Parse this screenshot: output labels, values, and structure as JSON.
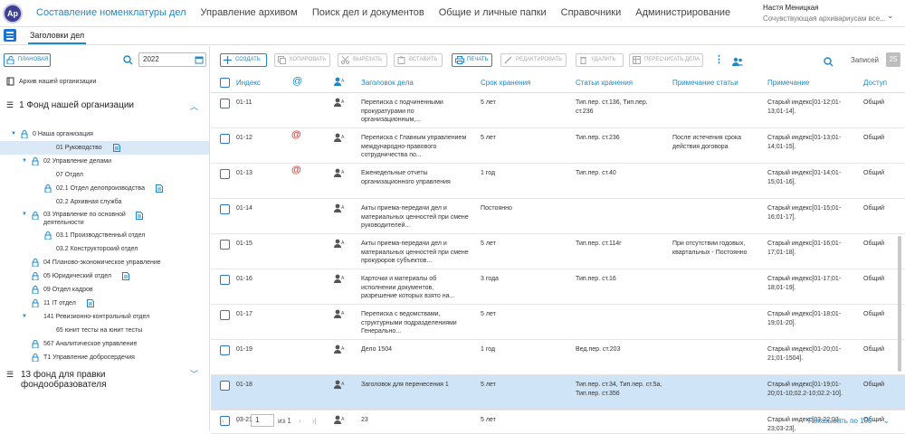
{
  "app": {
    "logo": "Ap",
    "nav": [
      "Составление номенклатуры дел",
      "Управление архивом",
      "Поиск дел и документов",
      "Общие и личные папки",
      "Справочники",
      "Администрирование"
    ],
    "user_name": "Настя Меницкая",
    "user_role": "Сочувствующая архивариусам все..."
  },
  "tab": "Заголовки дел",
  "left": {
    "plan_label": "ПЛАНОВАЯ",
    "year": "2022",
    "archive": "Архив нашей организации",
    "fond1": "1 Фонд нашей организации",
    "fond2": "13 фонд для правки фондообразователя",
    "tree": [
      {
        "label": "0 Наша организация",
        "level": 0,
        "arrow": true,
        "lock": true,
        "doc": false
      },
      {
        "label": "01 Руководство",
        "level": 2,
        "arrow": false,
        "lock": false,
        "doc": true,
        "selected": true
      },
      {
        "label": "02 Управление делами",
        "level": 1,
        "arrow": true,
        "lock": true,
        "doc": false
      },
      {
        "label": "07 Отдел",
        "level": 2,
        "arrow": false,
        "lock": false,
        "doc": false
      },
      {
        "label": "02.1 Отдел делопроизводства",
        "level": 2,
        "arrow": false,
        "lock": true,
        "doc": true
      },
      {
        "label": "02.2 Архивная служба",
        "level": 2,
        "arrow": false,
        "lock": false,
        "doc": false
      },
      {
        "label": "03 Управление по основной деятельности",
        "level": 1,
        "arrow": true,
        "lock": true,
        "doc": true,
        "two": true
      },
      {
        "label": "03.1 Производственный отдел",
        "level": 2,
        "arrow": false,
        "lock": true,
        "doc": false
      },
      {
        "label": "03.2 Конструкторский отдел",
        "level": 2,
        "arrow": false,
        "lock": false,
        "doc": false
      },
      {
        "label": "04 Планово-экономическое управление",
        "level": 1,
        "arrow": false,
        "lock": true,
        "doc": false
      },
      {
        "label": "05 Юридический отдел",
        "level": 1,
        "arrow": false,
        "lock": true,
        "doc": true
      },
      {
        "label": "09 Отдел кадров",
        "level": 1,
        "arrow": false,
        "lock": true,
        "doc": false
      },
      {
        "label": "11 IT отдел",
        "level": 1,
        "arrow": false,
        "lock": true,
        "doc": true
      },
      {
        "label": "141 Ревизионно-контрольный отдел",
        "level": 1,
        "arrow": true,
        "lock": false,
        "doc": false
      },
      {
        "label": "65 юнит тесты на юнит тесты",
        "level": 2,
        "arrow": false,
        "lock": false,
        "doc": false
      },
      {
        "label": "567 Аналитическое управление",
        "level": 1,
        "arrow": false,
        "lock": true,
        "doc": false
      },
      {
        "label": "T1 Управление добросердечия",
        "level": 1,
        "arrow": false,
        "lock": true,
        "doc": false
      }
    ]
  },
  "toolbar": {
    "create": "СОЗДАТЬ",
    "copy": "КОПИРОВАТЬ",
    "cut": "ВЫРЕЗАТЬ",
    "paste": "ВСТАВИТЬ",
    "print": "ПЕЧАТЬ",
    "edit": "РЕДАКТИРОВАТЬ",
    "delete": "УДАЛИТЬ",
    "recalc": "ПЕРЕСЧИТАТЬ ДЕЛА",
    "records_label": "Записей",
    "records_count": "25"
  },
  "table": {
    "headers": {
      "index": "Индекс",
      "at": "@",
      "title": "Заголовок дела",
      "term": "Срок хранения",
      "articles": "Статьи хранения",
      "art_note": "Примечание статьи",
      "note": "Примечание",
      "access": "Доступ"
    },
    "rows": [
      {
        "index": "01-11",
        "at": "",
        "title": "Переписка с подчиненными прокуратурами по организационным,...",
        "term": "5 лет",
        "articles": "Тип.пер. ст.136, Тип.пер. ст.236",
        "art_note": "",
        "note": "Старый индекс[01-12;01-13;01-14].",
        "access": "Общий"
      },
      {
        "index": "01-12",
        "at": "@",
        "title": "Переписка с Главным управлением международно-правового сотрудничества по...",
        "term": "5 лет",
        "articles": "Тип.пер. ст.236",
        "art_note": "После истечения срока действия договора",
        "note": "Старый индекс[01-13;01-14;01-15].",
        "access": "Общий"
      },
      {
        "index": "01-13",
        "at": "@",
        "title": "Еженедельные отчеты организационного управления",
        "term": "1 год",
        "articles": "Тип.пер. ст.40",
        "art_note": "",
        "note": "Старый индекс[01-14;01-15;01-16].",
        "access": "Общий"
      },
      {
        "index": "01-14",
        "at": "",
        "title": "Акты приема-передачи дел и материальных ценностей при смене руководителей...",
        "term": "Постоянно",
        "articles": "",
        "art_note": "",
        "note": "Старый индекс[01-15;01-16;01-17].",
        "access": "Общий"
      },
      {
        "index": "01-15",
        "at": "",
        "title": "Акты приема-передачи дел и материальных ценностей при смене прокуроров субъектов...",
        "term": "5 лет",
        "articles": "Тип.пер. ст.114г",
        "art_note": "При отсутствии годовых, квартальных - Постоянно",
        "note": "Старый индекс[01-16;01-17;01-18].",
        "access": "Общий"
      },
      {
        "index": "01-16",
        "at": "",
        "title": "Карточки и материалы об исполнении документов, разрешение которых взято на...",
        "term": "3 года",
        "articles": "Тип.пер. ст.16",
        "art_note": "",
        "note": "Старый индекс[01-17;01-18;01-19].",
        "access": "Общий"
      },
      {
        "index": "01-17",
        "at": "",
        "title": "Переписка с ведомствами, структурными подразделениями Генерально...",
        "term": "5 лет",
        "articles": "",
        "art_note": "",
        "note": "Старый индекс[01-18;01-19;01-20].",
        "access": "Общий"
      },
      {
        "index": "01-19",
        "at": "",
        "title": "Дело 1504",
        "term": "1 год",
        "articles": "Вед.пер. ст.203",
        "art_note": "",
        "note": "Старый индекс[01-20;01-21;01-1504].",
        "access": "Общий"
      },
      {
        "index": "01-18",
        "at": "",
        "title": "Заголовок для перенесения 1",
        "term": "5 лет",
        "articles": "Тип.пер. ст.34, Тип.пер. ст.5а, Тип.пер. ст.356",
        "art_note": "",
        "note": "Старый индекс[01-19;01-20;01-10;02.2-10;02.2-10].",
        "access": "Общий",
        "selected": true
      },
      {
        "index": "03-21",
        "at": "",
        "title": "23",
        "term": "5 лет",
        "articles": "",
        "art_note": "",
        "note": "Старый индекс[03-22;03-23;03-23].",
        "access": "Общий"
      }
    ]
  },
  "pager": {
    "page": "1",
    "of": "из 1",
    "show_by": "Показывать по 100"
  }
}
